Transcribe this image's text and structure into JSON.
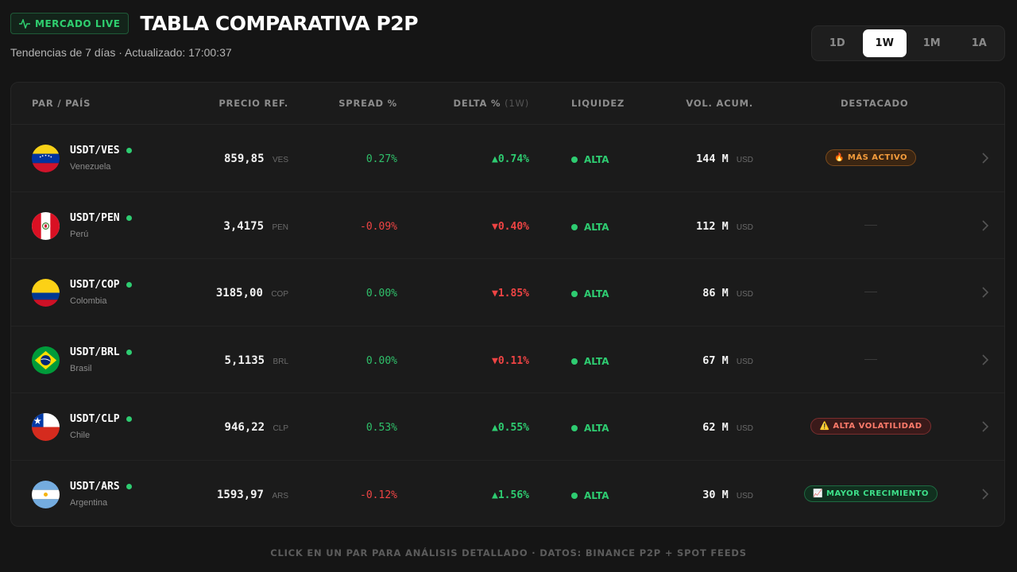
{
  "header": {
    "live_badge": "MERCADO LIVE",
    "title": "TABLA COMPARATIVA P2P",
    "subtitle": "Tendencias de 7 días · Actualizado: 17:00:37"
  },
  "periods": [
    {
      "label": "1D",
      "active": false
    },
    {
      "label": "1W",
      "active": true
    },
    {
      "label": "1M",
      "active": false
    },
    {
      "label": "1A",
      "active": false
    }
  ],
  "table": {
    "columns": {
      "pair": "PAR / PAÍS",
      "price": "PRECIO REF.",
      "spread": "SPREAD %",
      "delta": "DELTA %",
      "delta_period": "(1W)",
      "liquidity": "LIQUIDEZ",
      "volume": "VOL. ACUM.",
      "highlight": "DESTACADO"
    },
    "rows": [
      {
        "pair": "USDT/VES",
        "country": "Venezuela",
        "flag": "venezuela-flag",
        "price": "859,85",
        "currency": "VES",
        "spread": "0.27%",
        "spread_sign": "pos",
        "delta": "▲0.74%",
        "delta_sign": "pos",
        "liquidity": "ALTA",
        "volume": "144 M",
        "volume_unit": "USD",
        "highlight": "🔥 MÁS ACTIVO",
        "highlight_style": "orange"
      },
      {
        "pair": "USDT/PEN",
        "country": "Perú",
        "flag": "peru-flag",
        "price": "3,4175",
        "currency": "PEN",
        "spread": "-0.09%",
        "spread_sign": "neg",
        "delta": "▼0.40%",
        "delta_sign": "neg",
        "liquidity": "ALTA",
        "volume": "112 M",
        "volume_unit": "USD",
        "highlight": "",
        "highlight_style": "none"
      },
      {
        "pair": "USDT/COP",
        "country": "Colombia",
        "flag": "colombia-flag",
        "price": "3185,00",
        "currency": "COP",
        "spread": "0.00%",
        "spread_sign": "pos",
        "delta": "▼1.85%",
        "delta_sign": "neg",
        "liquidity": "ALTA",
        "volume": "86 M",
        "volume_unit": "USD",
        "highlight": "",
        "highlight_style": "none"
      },
      {
        "pair": "USDT/BRL",
        "country": "Brasil",
        "flag": "brazil-flag",
        "price": "5,1135",
        "currency": "BRL",
        "spread": "0.00%",
        "spread_sign": "pos",
        "delta": "▼0.11%",
        "delta_sign": "neg",
        "liquidity": "ALTA",
        "volume": "67 M",
        "volume_unit": "USD",
        "highlight": "",
        "highlight_style": "none"
      },
      {
        "pair": "USDT/CLP",
        "country": "Chile",
        "flag": "chile-flag",
        "price": "946,22",
        "currency": "CLP",
        "spread": "0.53%",
        "spread_sign": "pos",
        "delta": "▲0.55%",
        "delta_sign": "pos",
        "liquidity": "ALTA",
        "volume": "62 M",
        "volume_unit": "USD",
        "highlight": "⚠️ ALTA VOLATILIDAD",
        "highlight_style": "red"
      },
      {
        "pair": "USDT/ARS",
        "country": "Argentina",
        "flag": "argentina-flag",
        "price": "1593,97",
        "currency": "ARS",
        "spread": "-0.12%",
        "spread_sign": "neg",
        "delta": "▲1.56%",
        "delta_sign": "pos",
        "liquidity": "ALTA",
        "volume": "30 M",
        "volume_unit": "USD",
        "highlight": "📈 MAYOR CRECIMIENTO",
        "highlight_style": "green"
      }
    ]
  },
  "footer": "CLICK EN UN PAR PARA ANÁLISIS DETALLADO · DATOS: BINANCE P2P + SPOT FEEDS",
  "colors": {
    "background": "#151515",
    "positive": "#2ecc71",
    "negative": "#ef4444",
    "active_period_bg": "#ffffff"
  }
}
